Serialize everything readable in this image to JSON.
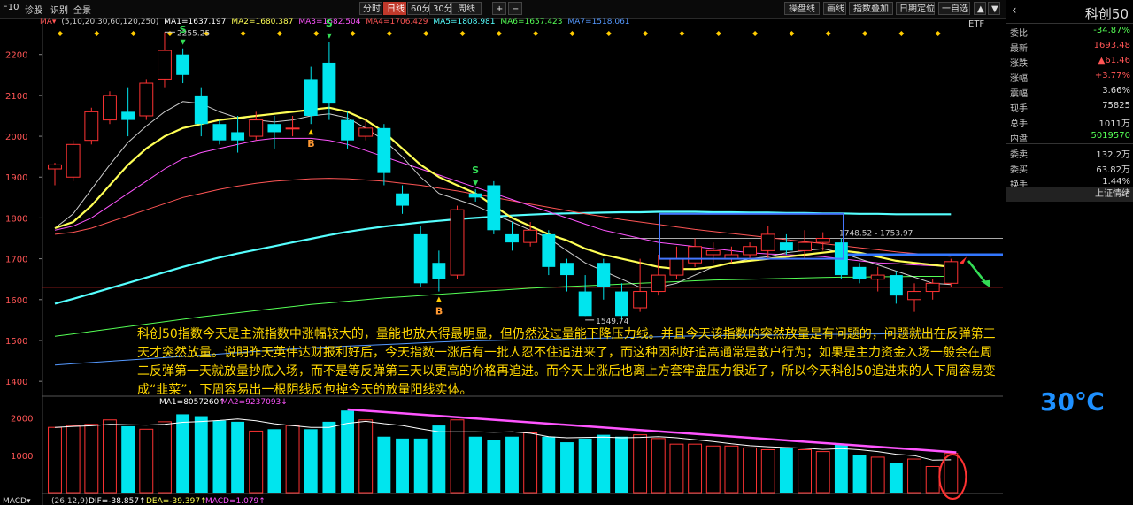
{
  "toolbar": {
    "left_tabs": [
      "F10",
      "诊股",
      "识别",
      "全景"
    ],
    "period_tabs": [
      "分时",
      "日线",
      "60分",
      "30分",
      "周线"
    ],
    "active_period": "日线",
    "zoom_plus": "+",
    "zoom_minus": "−",
    "right_buttons": [
      "操盘线",
      "画线",
      "指数叠加",
      "日期定位",
      "一自选"
    ],
    "arrows": [
      "▲",
      "▼"
    ]
  },
  "ma_header": {
    "selector": "MA▾",
    "params": "(5,10,20,30,60,120,250)",
    "items": [
      {
        "label": "MA1=1637.197",
        "color": "#ffffff"
      },
      {
        "label": "MA2=1680.387",
        "color": "#ffff55"
      },
      {
        "label": "MA3=1682.504",
        "color": "#ff55ff"
      },
      {
        "label": "MA4=1706.429",
        "color": "#ff5555"
      },
      {
        "label": "MA5=1808.981",
        "color": "#55ffff"
      },
      {
        "label": "MA6=1657.423",
        "color": "#55ff55"
      },
      {
        "label": "MA7=1518.061",
        "color": "#5599ff"
      }
    ]
  },
  "etf_label": "ETF",
  "vol_header": {
    "items": [
      {
        "label": "MA1=8057260↑",
        "color": "#ffffff"
      },
      {
        "label": "MA2=9237093↓",
        "color": "#ff55ff"
      }
    ]
  },
  "macd_header": {
    "name": "MACD▾",
    "params": "(26,12,9)",
    "items": [
      {
        "label": "DIF=-38.857↑",
        "color": "#ffffff"
      },
      {
        "label": "DEA=-39.397↑",
        "color": "#ffff55"
      },
      {
        "label": "MACD=1.079↑",
        "color": "#ff55ff"
      }
    ]
  },
  "annotation": "科创50指数今天是主流指数中涨幅较大的，量能也放大得最明显，但仍然没过量能下降压力线。并且今天该指数的突然放量是有问题的，问题就出在反弹第三天才突然放量。说明昨天英伟达财报利好后，今天指数一涨后有一批人忍不住追进来了，而这种因利好追高通常是散户行为；如果是主力资金入场一般会在周二反弹第一天就放量抄底入场，而不是等反弹第三天以更高的价格再追进。而今天上涨后也离上方套牢盘压力很近了，所以今天科创50追进来的人下周容易变成“韭菜”，下周容易出一根阴线反包掉今天的放量阳线实体。",
  "temperature": "30℃",
  "quote_panel": {
    "title": "科创50",
    "back": "‹",
    "rows": [
      {
        "k": "委比",
        "v": "-34.87%",
        "color": "#55ff55"
      },
      {
        "k": "最新",
        "v": "1693.48",
        "color": "#ff5555"
      },
      {
        "k": "涨跌",
        "v": "▲61.46",
        "color": "#ff5555"
      },
      {
        "k": "涨幅",
        "v": "+3.77%",
        "color": "#ff5555"
      },
      {
        "k": "震幅",
        "v": "3.66%",
        "color": "#dddddd"
      },
      {
        "k": "现手",
        "v": "75825",
        "color": "#dddddd"
      },
      {
        "k": "总手",
        "v": "1011万",
        "color": "#dddddd"
      },
      {
        "k": "内盘",
        "v": "5019570",
        "color": "#55ff55"
      },
      {
        "k": "委卖",
        "v": "132.2万",
        "color": "#dddddd"
      },
      {
        "k": "委买",
        "v": "63.82万",
        "color": "#dddddd"
      },
      {
        "k": "换手",
        "v": "1.44%",
        "color": "#dddddd"
      }
    ],
    "footer": "上证情绪"
  },
  "chart_data": {
    "type": "candlestick",
    "y_axis": {
      "range": [
        1370,
        2260
      ],
      "ticks": [
        1400,
        1500,
        1600,
        1700,
        1800,
        1900,
        2000,
        2100,
        2200
      ]
    },
    "colors": {
      "up": "#ff3333",
      "down": "#00e5ee",
      "ma1": "#ffffff",
      "ma2": "#ffff55",
      "ma3": "#ff55ff",
      "ma4": "#ff5555",
      "ma5": "#55ffff",
      "ma6": "#55ff55",
      "ma7": "#5599ff"
    },
    "candles": [
      [
        1920,
        1930,
        1880,
        1935
      ],
      [
        1900,
        1980,
        1890,
        1990
      ],
      [
        1990,
        2060,
        1980,
        2070
      ],
      [
        2040,
        2100,
        2030,
        2110
      ],
      [
        2060,
        2040,
        2000,
        2120
      ],
      [
        2050,
        2130,
        2040,
        2140
      ],
      [
        2140,
        2210,
        2120,
        2255
      ],
      [
        2200,
        2150,
        2130,
        2215
      ],
      [
        2100,
        2030,
        2000,
        2120
      ],
      [
        2030,
        1990,
        1980,
        2040
      ],
      [
        2010,
        1990,
        1960,
        2050
      ],
      [
        2000,
        2040,
        1990,
        2060
      ],
      [
        2030,
        2010,
        1970,
        2050
      ],
      [
        2020,
        2020,
        2000,
        2050
      ],
      [
        2140,
        2050,
        2030,
        2170
      ],
      [
        2180,
        2080,
        2040,
        2230
      ],
      [
        2040,
        1990,
        1970,
        2060
      ],
      [
        2000,
        2020,
        1990,
        2040
      ],
      [
        2020,
        1910,
        1880,
        2030
      ],
      [
        1860,
        1830,
        1810,
        1880
      ],
      [
        1760,
        1640,
        1630,
        1780
      ],
      [
        1690,
        1650,
        1620,
        1720
      ],
      [
        1660,
        1820,
        1650,
        1830
      ],
      [
        1860,
        1850,
        1840,
        1870
      ],
      [
        1880,
        1770,
        1760,
        1890
      ],
      [
        1760,
        1740,
        1720,
        1790
      ],
      [
        1740,
        1770,
        1730,
        1790
      ],
      [
        1760,
        1680,
        1660,
        1770
      ],
      [
        1690,
        1660,
        1620,
        1700
      ],
      [
        1620,
        1560,
        1560,
        1660
      ],
      [
        1690,
        1630,
        1600,
        1700
      ],
      [
        1620,
        1560,
        1550,
        1640
      ],
      [
        1580,
        1620,
        1570,
        1700
      ],
      [
        1620,
        1660,
        1610,
        1710
      ],
      [
        1660,
        1700,
        1650,
        1730
      ],
      [
        1690,
        1730,
        1680,
        1750
      ],
      [
        1710,
        1720,
        1690,
        1740
      ],
      [
        1700,
        1710,
        1690,
        1730
      ],
      [
        1710,
        1730,
        1700,
        1740
      ],
      [
        1720,
        1760,
        1700,
        1780
      ],
      [
        1740,
        1720,
        1710,
        1760
      ],
      [
        1720,
        1740,
        1700,
        1770
      ],
      [
        1740,
        1750,
        1720,
        1765
      ],
      [
        1740,
        1660,
        1650,
        1750
      ],
      [
        1680,
        1650,
        1640,
        1690
      ],
      [
        1650,
        1660,
        1620,
        1680
      ],
      [
        1660,
        1610,
        1590,
        1670
      ],
      [
        1600,
        1620,
        1570,
        1640
      ],
      [
        1620,
        1640,
        1600,
        1650
      ],
      [
        1640,
        1693,
        1630,
        1700
      ]
    ],
    "ma_lines": {
      "ma1": [
        1775,
        1810,
        1870,
        1930,
        1985,
        2025,
        2060,
        2085,
        2080,
        2060,
        2045,
        2040,
        2035,
        2040,
        2050,
        2055,
        2045,
        2020,
        1990,
        1950,
        1900,
        1860,
        1845,
        1830,
        1810,
        1790,
        1770,
        1750,
        1720,
        1690,
        1670,
        1650,
        1630,
        1630,
        1640,
        1660,
        1680,
        1690,
        1700,
        1705,
        1715,
        1720,
        1725,
        1715,
        1700,
        1685,
        1670,
        1655,
        1640,
        1637
      ],
      "ma2": [
        1775,
        1790,
        1830,
        1880,
        1930,
        1970,
        2000,
        2020,
        2030,
        2040,
        2045,
        2050,
        2055,
        2060,
        2065,
        2070,
        2060,
        2040,
        2010,
        1970,
        1930,
        1900,
        1880,
        1860,
        1830,
        1800,
        1780,
        1760,
        1745,
        1725,
        1710,
        1700,
        1690,
        1680,
        1675,
        1675,
        1680,
        1690,
        1695,
        1700,
        1705,
        1710,
        1715,
        1720,
        1715,
        1705,
        1695,
        1690,
        1685,
        1680
      ],
      "ma3": [
        1770,
        1780,
        1800,
        1830,
        1860,
        1890,
        1920,
        1945,
        1960,
        1970,
        1980,
        1990,
        1995,
        1995,
        1995,
        1990,
        1980,
        1965,
        1950,
        1935,
        1920,
        1905,
        1890,
        1875,
        1860,
        1845,
        1830,
        1815,
        1800,
        1785,
        1770,
        1760,
        1750,
        1740,
        1735,
        1730,
        1725,
        1720,
        1715,
        1712,
        1710,
        1708,
        1705,
        1700,
        1695,
        1690,
        1688,
        1685,
        1683,
        1682
      ],
      "ma4": [
        1760,
        1765,
        1775,
        1790,
        1805,
        1820,
        1835,
        1850,
        1860,
        1870,
        1878,
        1885,
        1890,
        1893,
        1896,
        1897,
        1896,
        1893,
        1890,
        1885,
        1880,
        1873,
        1866,
        1858,
        1850,
        1842,
        1834,
        1826,
        1818,
        1810,
        1803,
        1796,
        1790,
        1784,
        1778,
        1772,
        1767,
        1762,
        1757,
        1752,
        1747,
        1742,
        1737,
        1732,
        1727,
        1722,
        1717,
        1713,
        1709,
        1706
      ],
      "ma5": [
        1590,
        1602,
        1615,
        1628,
        1641,
        1654,
        1667,
        1680,
        1692,
        1703,
        1713,
        1722,
        1731,
        1740,
        1749,
        1758,
        1766,
        1773,
        1779,
        1784,
        1789,
        1793,
        1797,
        1800,
        1803,
        1806,
        1808,
        1810,
        1811,
        1812,
        1813,
        1814,
        1814,
        1815,
        1815,
        1815,
        1814,
        1814,
        1813,
        1813,
        1812,
        1812,
        1811,
        1811,
        1810,
        1810,
        1809,
        1809,
        1809,
        1809
      ],
      "ma6": [
        1510,
        1516,
        1522,
        1528,
        1534,
        1540,
        1546,
        1552,
        1558,
        1563,
        1568,
        1573,
        1578,
        1583,
        1588,
        1592,
        1596,
        1600,
        1604,
        1607,
        1610,
        1613,
        1616,
        1619,
        1622,
        1625,
        1628,
        1630,
        1632,
        1634,
        1636,
        1638,
        1640,
        1642,
        1644,
        1646,
        1648,
        1649,
        1650,
        1651,
        1652,
        1653,
        1654,
        1655,
        1655,
        1656,
        1656,
        1657,
        1657,
        1657
      ],
      "ma7": [
        1440,
        1443,
        1446,
        1449,
        1452,
        1455,
        1458,
        1461,
        1464,
        1467,
        1470,
        1473,
        1476,
        1479,
        1482,
        1484,
        1486,
        1488,
        1490,
        1492,
        1494,
        1496,
        1498,
        1499,
        1500,
        1501,
        1502,
        1503,
        1504,
        1505,
        1506,
        1507,
        1508,
        1509,
        1510,
        1511,
        1512,
        1512,
        1513,
        1513,
        1514,
        1514,
        1515,
        1515,
        1516,
        1516,
        1517,
        1517,
        1518,
        1518
      ]
    },
    "price_labels": [
      "2255.25",
      "1549.74",
      "1748.52 - 1753.97"
    ],
    "signals": [
      {
        "i": 7,
        "text": "S",
        "type": "sell"
      },
      {
        "i": 14,
        "text": "B",
        "type": "buy"
      },
      {
        "i": 15,
        "text": "S",
        "type": "sell"
      },
      {
        "i": 21,
        "text": "B",
        "type": "buy"
      },
      {
        "i": 23,
        "text": "S",
        "type": "sell"
      }
    ],
    "volume": {
      "y_ticks": [
        1000,
        2000
      ],
      "values": [
        1750,
        1800,
        1830,
        1950,
        1780,
        1700,
        1900,
        2100,
        2050,
        1930,
        1900,
        1650,
        1700,
        1800,
        1700,
        1900,
        2200,
        1950,
        1500,
        1450,
        1450,
        1800,
        1950,
        1500,
        1400,
        1500,
        1600,
        1500,
        1350,
        1450,
        1550,
        1500,
        1550,
        1450,
        1300,
        1300,
        1250,
        1250,
        1200,
        1150,
        1200,
        1150,
        1100,
        1300,
        1000,
        950,
        800,
        900,
        700,
        1050
      ],
      "up": [
        1,
        1,
        1,
        1,
        0,
        1,
        1,
        0,
        0,
        0,
        0,
        1,
        0,
        1,
        0,
        0,
        0,
        1,
        0,
        0,
        0,
        0,
        1,
        0,
        0,
        0,
        1,
        0,
        0,
        0,
        0,
        0,
        1,
        1,
        1,
        1,
        1,
        1,
        1,
        1,
        0,
        1,
        1,
        0,
        0,
        1,
        0,
        1,
        1,
        1
      ]
    },
    "macd": {
      "dif": -38.857,
      "dea": -39.397,
      "macd": 1.079
    }
  }
}
